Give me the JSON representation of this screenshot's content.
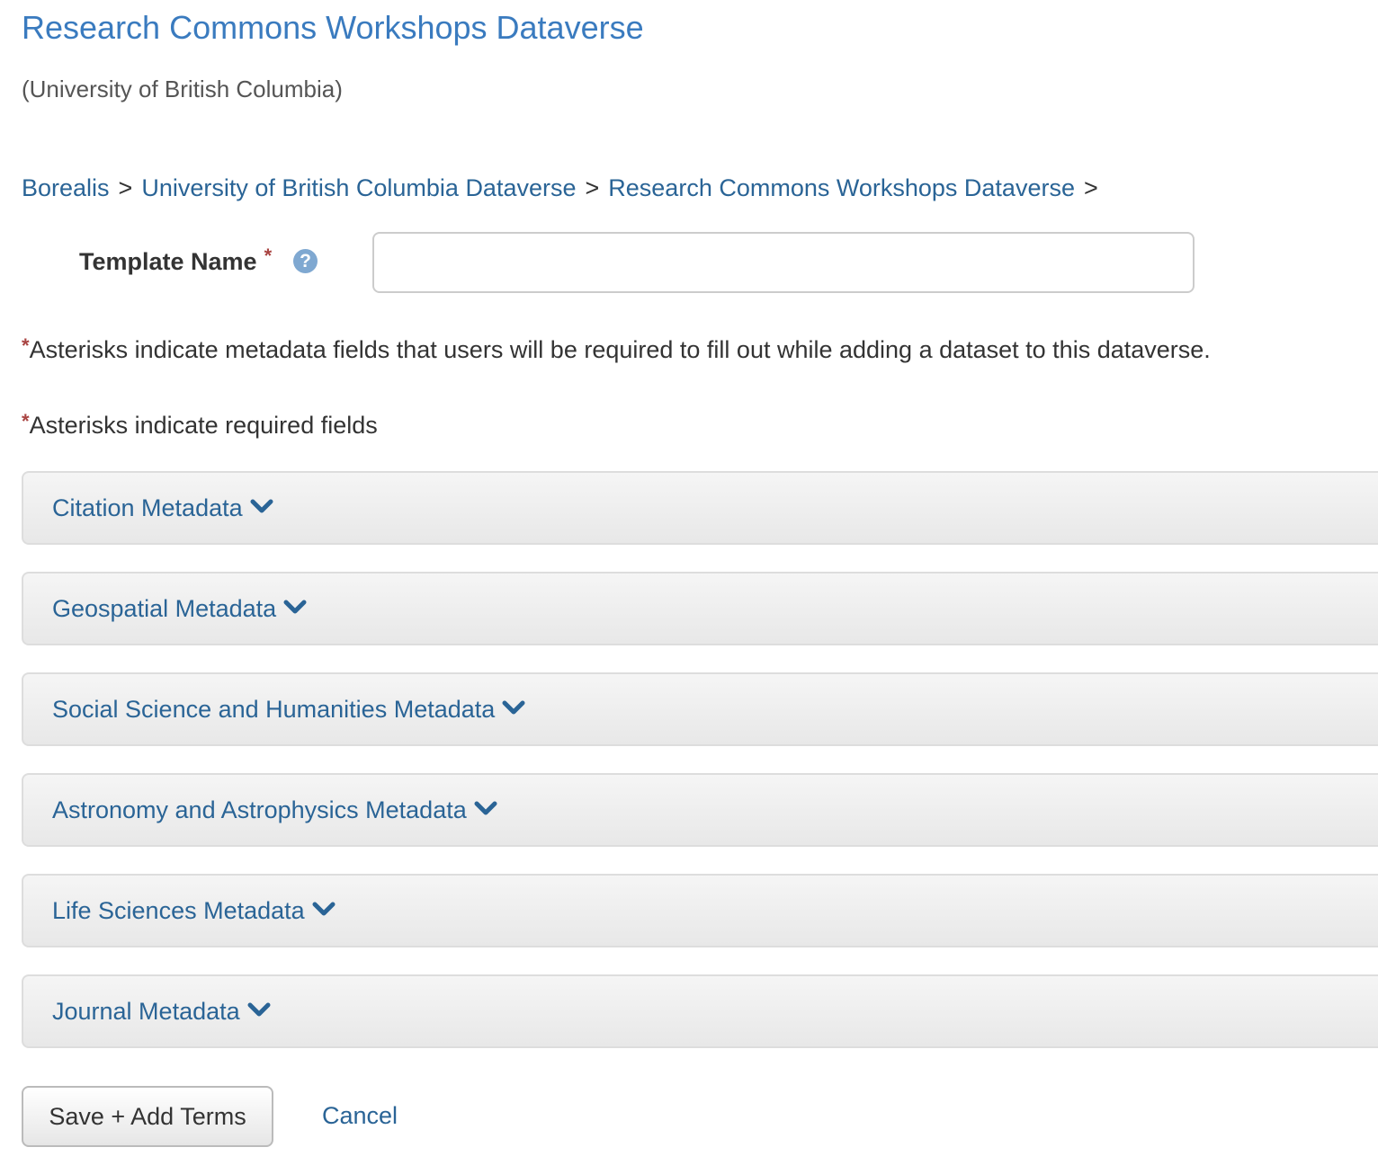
{
  "header": {
    "dataverse_title": "Research Commons Workshops Dataverse",
    "affiliation": "(University of British Columbia)"
  },
  "breadcrumb": {
    "items": [
      "Borealis",
      "University of British Columbia Dataverse",
      "Research Commons Workshops Dataverse"
    ],
    "separator": ">"
  },
  "form": {
    "template_name_label": "Template Name",
    "required_marker": "*",
    "help_icon_glyph": "?",
    "template_name_value": "",
    "template_name_placeholder": "",
    "note_metadata": "Asterisks indicate metadata fields that users will be required to fill out while adding a dataset to this dataverse.",
    "note_required": "Asterisks indicate required fields"
  },
  "panels": [
    {
      "label": "Citation Metadata"
    },
    {
      "label": "Geospatial Metadata"
    },
    {
      "label": "Social Science and Humanities Metadata"
    },
    {
      "label": "Astronomy and Astrophysics Metadata"
    },
    {
      "label": "Life Sciences Metadata"
    },
    {
      "label": "Journal Metadata"
    }
  ],
  "actions": {
    "save_label": "Save + Add Terms",
    "cancel_label": "Cancel"
  },
  "icons": {
    "help": "question-circle-icon",
    "expand": "chevron-down-icon"
  },
  "colors": {
    "link": "#2a6496",
    "title": "#3a7bbf",
    "required": "#a94442",
    "help_icon": "#7fa8d1"
  }
}
